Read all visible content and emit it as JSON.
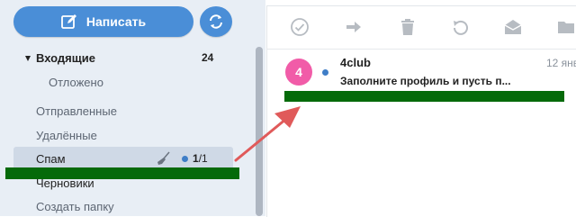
{
  "sidebar": {
    "compose_label": "Написать",
    "folders": {
      "inbox": {
        "label": "Входящие",
        "count": "24"
      },
      "postponed": "Отложено",
      "sent": "Отправленные",
      "deleted": "Удалённые",
      "spam": {
        "label": "Спам",
        "unread": "1",
        "total": "1"
      },
      "drafts": "Черновики",
      "create": "Создать папку"
    }
  },
  "toolbar": {
    "icons": [
      "check-circle-icon",
      "forward-arrow-icon",
      "trash-icon",
      "undo-icon",
      "envelope-icon",
      "folder-icon"
    ]
  },
  "messages": [
    {
      "avatar_text": "4",
      "sender": "4club",
      "date": "12 янв",
      "subject": "Заполните профиль и пусть п..."
    }
  ],
  "colors": {
    "accent": "#4a8ed7",
    "avatar": "#f15ca8",
    "highlight_bar": "#056a0a",
    "annotation_arrow": "#e05a5a"
  }
}
